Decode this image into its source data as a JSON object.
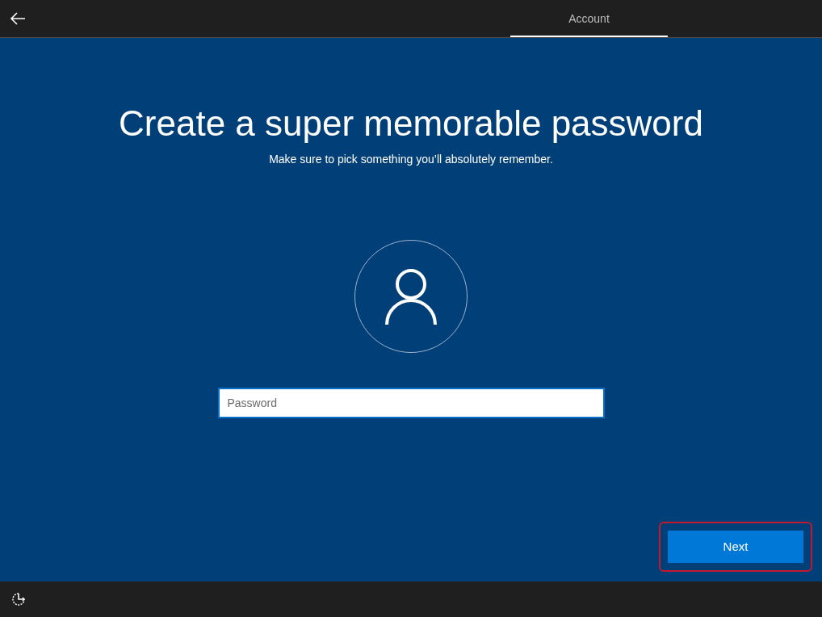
{
  "top_bar": {
    "tabs": [
      {
        "label": "Account",
        "selected": true
      }
    ]
  },
  "page": {
    "title": "Create a super memorable password",
    "subtitle": "Make sure to pick something you’ll absolutely remember.",
    "password_field": {
      "placeholder": "Password"
    }
  },
  "next_button": {
    "label": "Next",
    "highlighted": true
  }
}
